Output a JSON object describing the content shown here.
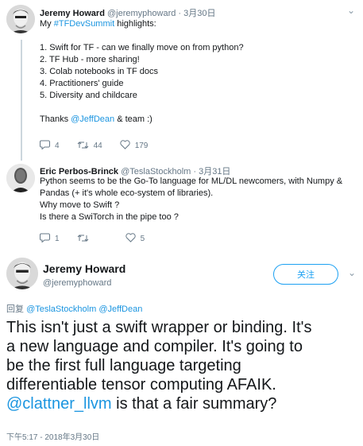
{
  "tweet1": {
    "name": "Jeremy Howard",
    "handle_date": "@jeremyphoward · 3月30日",
    "lines": [
      [
        "My ",
        {
          "link": "#TFDevSummit"
        },
        " highlights:"
      ],
      [
        ""
      ],
      [
        "1. Swift for TF - can we finally move on from python?"
      ],
      [
        "2. TF Hub - more sharing!"
      ],
      [
        "3. Colab notebooks in TF docs"
      ],
      [
        "4. Practitioners' guide"
      ],
      [
        "5. Diversity and childcare"
      ],
      [
        ""
      ],
      [
        "Thanks ",
        {
          "link": "@JeffDean"
        },
        " & team :)"
      ]
    ],
    "reply_count": "4",
    "retweet_count": "44",
    "like_count": "179"
  },
  "tweet2": {
    "name": "Eric Perbos-Brinck",
    "handle_date": "@TeslaStockholm · 3月31日",
    "lines": [
      [
        "Python seems to be the Go-To language for ML/DL newcomers, with Numpy &"
      ],
      [
        "Pandas (+ it's whole eco-system of libraries)."
      ],
      [
        "Why move to Swift ?"
      ],
      [
        "Is there a SwiTorch in the pipe too ?"
      ]
    ],
    "reply_count": "1",
    "retweet_count": "",
    "like_count": "5"
  },
  "main_tweet": {
    "name": "Jeremy Howard",
    "handle": "@jeremyphoward",
    "follow_label": "关注",
    "reply_prefix": "回复",
    "reply_to_1": "@TeslaStockholm",
    "reply_to_2": "@JeffDean",
    "lines": [
      [
        "This isn't just a swift wrapper or binding. It's"
      ],
      [
        "a new language and compiler. It's going to"
      ],
      [
        "be the first full language targeting"
      ],
      [
        "differentiable tensor computing AFAIK."
      ],
      [
        {
          "link": "@clattner_llvm"
        },
        " is that a fair summary?"
      ]
    ],
    "timestamp": "下午5:17 - 2018年3月30日"
  },
  "icons": {
    "reply": "reply-icon",
    "retweet": "retweet-icon",
    "like": "heart-icon",
    "more": "chevron-down-icon"
  },
  "colors": {
    "link": "#1b95e0",
    "follow": "#1da1f2",
    "muted": "#657786",
    "text": "#14171a"
  }
}
